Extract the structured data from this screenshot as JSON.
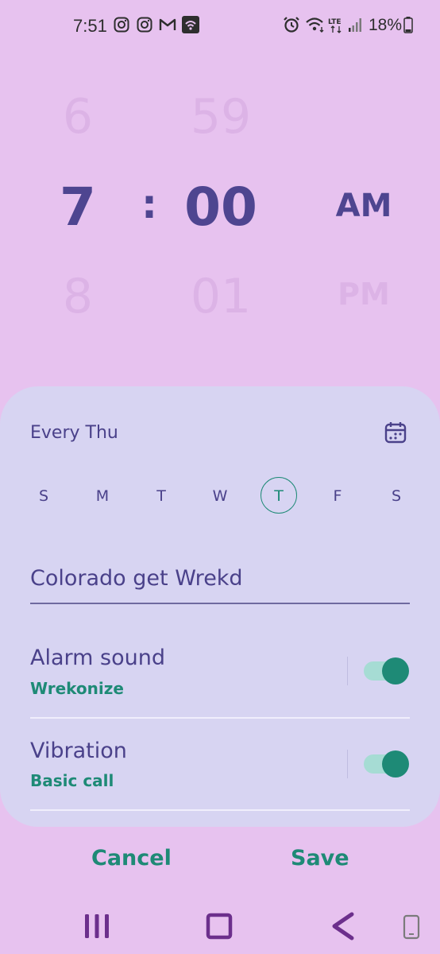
{
  "status_bar": {
    "time": "7:51",
    "battery": "18%",
    "network": "LTE",
    "icons": [
      "instagram-icon",
      "instagram-icon",
      "gmail-icon",
      "hotspot-icon",
      "alarm-icon",
      "wifi-icon",
      "lte-icon",
      "signal-icon",
      "battery-icon"
    ]
  },
  "picker": {
    "hour_prev": "6",
    "hour": "7",
    "hour_next": "8",
    "separator": ":",
    "minute_prev": "59",
    "minute": "00",
    "minute_next": "01",
    "ampm": "AM",
    "ampm_next": "PM"
  },
  "repeat": {
    "label": "Every Thu",
    "days": [
      "S",
      "M",
      "T",
      "W",
      "T",
      "F",
      "S"
    ],
    "selected_index": 4
  },
  "alarm_name": "Colorado get Wrekd",
  "alarm_sound": {
    "title": "Alarm sound",
    "value": "Wrekonize",
    "enabled": true
  },
  "vibration": {
    "title": "Vibration",
    "value": "Basic call",
    "enabled": true
  },
  "actions": {
    "cancel": "Cancel",
    "save": "Save"
  },
  "colors": {
    "background": "#e7c2ef",
    "card": "#d7d4f2",
    "accent": "#1e8a76",
    "text": "#4a418a"
  }
}
